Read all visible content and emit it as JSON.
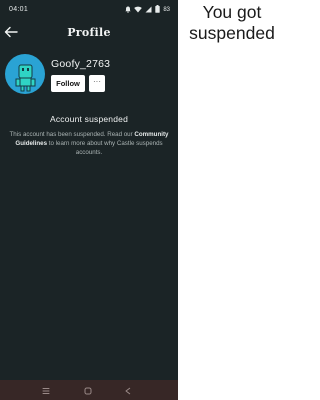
{
  "status_bar": {
    "time": "04:01",
    "battery": "83"
  },
  "header": {
    "title": "Profile"
  },
  "profile": {
    "username": "Goofy_2763",
    "follow_label": "Follow",
    "more_label": "···",
    "avatar_color": "#2aa3d4"
  },
  "suspension": {
    "title": "Account suspended",
    "body_prefix": "This account has been suspended. Read our",
    "link_text": "Community Guidelines",
    "body_suffix": "to learn more about why Castle suspends accounts."
  },
  "caption": "You got suspended",
  "colors": {
    "screen_bg": "#1b2426",
    "nav_bg": "#372726",
    "accent": "#2aa3d4"
  },
  "icons": [
    "back-arrow-icon",
    "wifi-icon",
    "signal-icon",
    "battery-icon",
    "menu-icon",
    "home-icon",
    "back-nav-icon"
  ]
}
